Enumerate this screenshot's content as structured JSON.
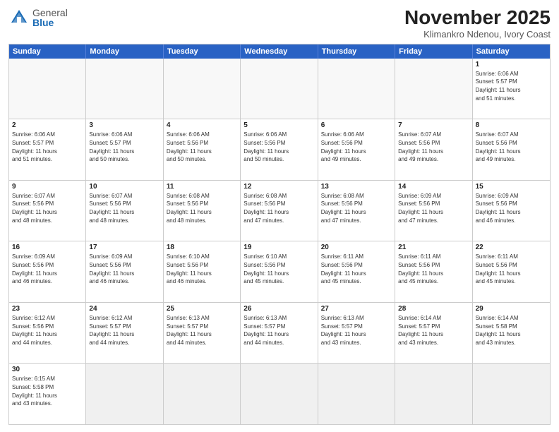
{
  "logo": {
    "general": "General",
    "blue": "Blue"
  },
  "title": "November 2025",
  "subtitle": "Klimankro Ndenou, Ivory Coast",
  "header_days": [
    "Sunday",
    "Monday",
    "Tuesday",
    "Wednesday",
    "Thursday",
    "Friday",
    "Saturday"
  ],
  "rows": [
    [
      {
        "day": "",
        "info": ""
      },
      {
        "day": "",
        "info": ""
      },
      {
        "day": "",
        "info": ""
      },
      {
        "day": "",
        "info": ""
      },
      {
        "day": "",
        "info": ""
      },
      {
        "day": "",
        "info": ""
      },
      {
        "day": "1",
        "info": "Sunrise: 6:06 AM\nSunset: 5:57 PM\nDaylight: 11 hours\nand 51 minutes."
      }
    ],
    [
      {
        "day": "2",
        "info": "Sunrise: 6:06 AM\nSunset: 5:57 PM\nDaylight: 11 hours\nand 51 minutes."
      },
      {
        "day": "3",
        "info": "Sunrise: 6:06 AM\nSunset: 5:57 PM\nDaylight: 11 hours\nand 50 minutes."
      },
      {
        "day": "4",
        "info": "Sunrise: 6:06 AM\nSunset: 5:56 PM\nDaylight: 11 hours\nand 50 minutes."
      },
      {
        "day": "5",
        "info": "Sunrise: 6:06 AM\nSunset: 5:56 PM\nDaylight: 11 hours\nand 50 minutes."
      },
      {
        "day": "6",
        "info": "Sunrise: 6:06 AM\nSunset: 5:56 PM\nDaylight: 11 hours\nand 49 minutes."
      },
      {
        "day": "7",
        "info": "Sunrise: 6:07 AM\nSunset: 5:56 PM\nDaylight: 11 hours\nand 49 minutes."
      },
      {
        "day": "8",
        "info": "Sunrise: 6:07 AM\nSunset: 5:56 PM\nDaylight: 11 hours\nand 49 minutes."
      }
    ],
    [
      {
        "day": "9",
        "info": "Sunrise: 6:07 AM\nSunset: 5:56 PM\nDaylight: 11 hours\nand 48 minutes."
      },
      {
        "day": "10",
        "info": "Sunrise: 6:07 AM\nSunset: 5:56 PM\nDaylight: 11 hours\nand 48 minutes."
      },
      {
        "day": "11",
        "info": "Sunrise: 6:08 AM\nSunset: 5:56 PM\nDaylight: 11 hours\nand 48 minutes."
      },
      {
        "day": "12",
        "info": "Sunrise: 6:08 AM\nSunset: 5:56 PM\nDaylight: 11 hours\nand 47 minutes."
      },
      {
        "day": "13",
        "info": "Sunrise: 6:08 AM\nSunset: 5:56 PM\nDaylight: 11 hours\nand 47 minutes."
      },
      {
        "day": "14",
        "info": "Sunrise: 6:09 AM\nSunset: 5:56 PM\nDaylight: 11 hours\nand 47 minutes."
      },
      {
        "day": "15",
        "info": "Sunrise: 6:09 AM\nSunset: 5:56 PM\nDaylight: 11 hours\nand 46 minutes."
      }
    ],
    [
      {
        "day": "16",
        "info": "Sunrise: 6:09 AM\nSunset: 5:56 PM\nDaylight: 11 hours\nand 46 minutes."
      },
      {
        "day": "17",
        "info": "Sunrise: 6:09 AM\nSunset: 5:56 PM\nDaylight: 11 hours\nand 46 minutes."
      },
      {
        "day": "18",
        "info": "Sunrise: 6:10 AM\nSunset: 5:56 PM\nDaylight: 11 hours\nand 46 minutes."
      },
      {
        "day": "19",
        "info": "Sunrise: 6:10 AM\nSunset: 5:56 PM\nDaylight: 11 hours\nand 45 minutes."
      },
      {
        "day": "20",
        "info": "Sunrise: 6:11 AM\nSunset: 5:56 PM\nDaylight: 11 hours\nand 45 minutes."
      },
      {
        "day": "21",
        "info": "Sunrise: 6:11 AM\nSunset: 5:56 PM\nDaylight: 11 hours\nand 45 minutes."
      },
      {
        "day": "22",
        "info": "Sunrise: 6:11 AM\nSunset: 5:56 PM\nDaylight: 11 hours\nand 45 minutes."
      }
    ],
    [
      {
        "day": "23",
        "info": "Sunrise: 6:12 AM\nSunset: 5:56 PM\nDaylight: 11 hours\nand 44 minutes."
      },
      {
        "day": "24",
        "info": "Sunrise: 6:12 AM\nSunset: 5:57 PM\nDaylight: 11 hours\nand 44 minutes."
      },
      {
        "day": "25",
        "info": "Sunrise: 6:13 AM\nSunset: 5:57 PM\nDaylight: 11 hours\nand 44 minutes."
      },
      {
        "day": "26",
        "info": "Sunrise: 6:13 AM\nSunset: 5:57 PM\nDaylight: 11 hours\nand 44 minutes."
      },
      {
        "day": "27",
        "info": "Sunrise: 6:13 AM\nSunset: 5:57 PM\nDaylight: 11 hours\nand 43 minutes."
      },
      {
        "day": "28",
        "info": "Sunrise: 6:14 AM\nSunset: 5:57 PM\nDaylight: 11 hours\nand 43 minutes."
      },
      {
        "day": "29",
        "info": "Sunrise: 6:14 AM\nSunset: 5:58 PM\nDaylight: 11 hours\nand 43 minutes."
      }
    ],
    [
      {
        "day": "30",
        "info": "Sunrise: 6:15 AM\nSunset: 5:58 PM\nDaylight: 11 hours\nand 43 minutes."
      },
      {
        "day": "",
        "info": ""
      },
      {
        "day": "",
        "info": ""
      },
      {
        "day": "",
        "info": ""
      },
      {
        "day": "",
        "info": ""
      },
      {
        "day": "",
        "info": ""
      },
      {
        "day": "",
        "info": ""
      }
    ]
  ]
}
